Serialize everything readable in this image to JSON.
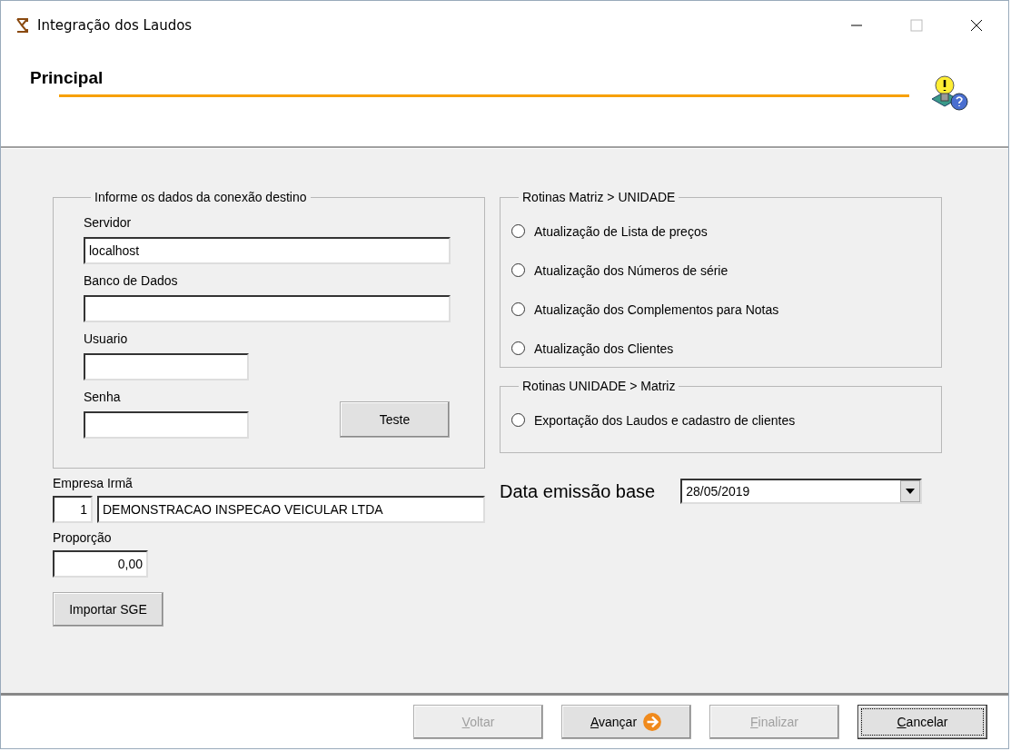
{
  "window": {
    "title": "Integração dos Laudos"
  },
  "header": {
    "title": "Principal"
  },
  "connection": {
    "legend": "Informe os dados da conexão destino",
    "fields": [
      {
        "label": "Servidor",
        "value": "localhost"
      },
      {
        "label": "Banco de Dados"
      },
      {
        "label": "Usuario"
      },
      {
        "label": "Senha"
      }
    ],
    "test_button": "Teste"
  },
  "matriz_to_unidade": {
    "legend": "Rotinas Matriz > UNIDADE",
    "options": [
      {
        "label": "Atualização de Lista de preços",
        "selected": false
      },
      {
        "label": "Atualização dos Números de série",
        "selected": false
      },
      {
        "label": "Atualização dos Complementos para Notas",
        "selected": false
      },
      {
        "label": "Atualização dos Clientes",
        "selected": false
      }
    ]
  },
  "unidade_to_matriz": {
    "legend": "Rotinas UNIDADE > Matriz",
    "options": [
      {
        "label": "Exportação dos Laudos e cadastro de clientes",
        "selected": false
      }
    ]
  },
  "empresa": {
    "label": "Empresa Irmã",
    "code": "1",
    "name": "DEMONSTRACAO INSPECAO VEICULAR LTDA"
  },
  "proporcao": {
    "label": "Proporção",
    "value": "0,00"
  },
  "import_button": "Importar SGE",
  "data_emissao": {
    "label": "Data emissão base",
    "value": "28/05/2019"
  },
  "footer_buttons": [
    {
      "label": "Voltar",
      "disabled": true,
      "arrow": false
    },
    {
      "label": "Avançar",
      "disabled": false,
      "arrow": true
    },
    {
      "label": "Finalizar",
      "disabled": true,
      "arrow": false
    },
    {
      "label": "Cancelar",
      "disabled": false,
      "arrow": false
    }
  ]
}
